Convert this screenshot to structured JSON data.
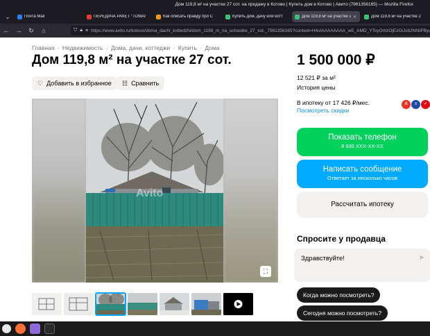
{
  "window": {
    "title": "Дом 119,8 м² на участке 27 сот. на продажу в Котово | Купить дом в Котово | Авито (7961356165) — Mozilla Firefox"
  },
  "tabs": [
    {
      "label": "Почта Mail",
      "favicon_color": "#2d7ff9",
      "active": false
    },
    {
      "label": "ПЕРЕДАЧА РАКЕТ \"ТОМАГ",
      "favicon_color": "#e53935",
      "active": false
    },
    {
      "label": "Как описать правду про С",
      "favicon_color": "#f39c12",
      "active": false
    },
    {
      "label": "Купить дом, дачу или котт",
      "favicon_color": "#3ac27b",
      "active": false
    },
    {
      "label": "Дом 119,8 м² на участке 2",
      "favicon_color": "#3ac27b",
      "active": true
    },
    {
      "label": "Дом 119,8 м² на участке 2",
      "favicon_color": "#3ac27b",
      "active": false
    }
  ],
  "nav": {
    "url": "https://www.avito.ru/kotovo/doma_dachi_kottedzhi/dom_1198_m_na_uchastke_27_sot._7961356165?context=H4sIAAAAAAAA_wE_AMD_YToyOntzOjEzOiJsb2NhbFByaW9yaXR5IjtiOjA7czoxOiJ4IjtzOjE2"
  },
  "breadcrumb": [
    "Главная",
    "Недвижимость",
    "Дома, дачи, коттеджи",
    "Купить",
    "Дома"
  ],
  "breadcrumb_sep": "·",
  "listing": {
    "title": "Дом 119,8 м² на участке 27 сот.",
    "favorite_label": "Добавить в избранное",
    "compare_label": "Сравнить",
    "watermark": "Avito"
  },
  "price": {
    "value": "1 500 000 ₽",
    "per_m2": "12 521 ₽ за м²",
    "history": "История цены",
    "mortgage": "В ипотеку от 17 426 ₽/мес.",
    "discounts": "Посмотреть скидки"
  },
  "banks": [
    {
      "letter": "А",
      "color": "#ef3124"
    },
    {
      "letter": "≡",
      "color": "#1f4aa8"
    },
    {
      "letter": "✓",
      "color": "#e30613"
    }
  ],
  "actions": {
    "phone_label": "Показать телефон",
    "phone_number": "8 936 XXX-XX-XX",
    "message_label": "Написать сообщение",
    "message_sub": "Ответает за несколько часов",
    "calc_label": "Рассчитать ипотеку"
  },
  "ask": {
    "title": "Спросите у продавца",
    "greeting": "Здравствуйте!",
    "chips": [
      "Когда можно посмотреть?",
      "Сегодня можно посмотреть?"
    ]
  },
  "thumbnails": [
    {
      "name": "thumb-plan-1",
      "active": false
    },
    {
      "name": "thumb-plan-2",
      "active": false
    },
    {
      "name": "thumb-house-fence",
      "active": true
    },
    {
      "name": "thumb-house-yard",
      "active": false
    },
    {
      "name": "thumb-house-snow",
      "active": false
    },
    {
      "name": "thumb-house-blue",
      "active": false
    },
    {
      "name": "thumb-video",
      "active": false
    }
  ]
}
